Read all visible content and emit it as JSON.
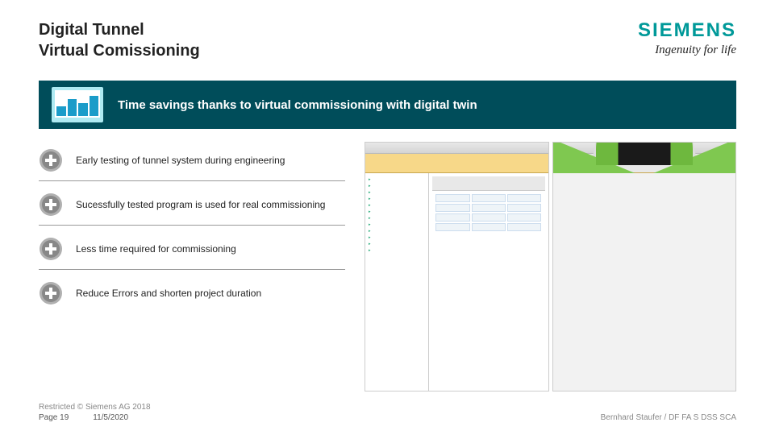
{
  "header": {
    "title_line1": "Digital Tunnel",
    "title_line2": "Virtual Comissioning",
    "logo": "SIEMENS",
    "tagline": "Ingenuity for life"
  },
  "banner": {
    "text": "Time savings thanks to virtual commissioning with digital twin"
  },
  "benefits": [
    {
      "text": "Early testing of tunnel system during engineering"
    },
    {
      "text": "Sucessfully tested program is used for real commissioning"
    },
    {
      "text": "Less time required for commissioning"
    },
    {
      "text": "Reduce Errors and shorten project duration"
    }
  ],
  "footer": {
    "restricted": "Restricted © Siemens AG 2018",
    "page": "Page 19",
    "date": "11/5/2020",
    "author": "Bernhard Staufer / DF FA S DSS SCA"
  }
}
